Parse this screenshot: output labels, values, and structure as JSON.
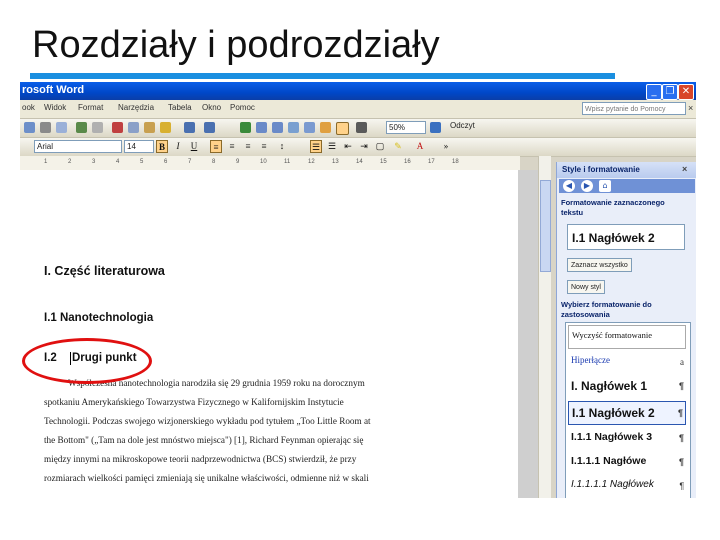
{
  "slide": {
    "title": "Rozdziały i podrozdziały"
  },
  "window": {
    "title": "rosoft Word"
  },
  "menu": [
    "ook",
    "Widok",
    "Format",
    "Narzędzia",
    "Tabela",
    "Okno",
    "Pomoc"
  ],
  "ask_placeholder": "Wpisz pytanie do Pomocy",
  "standard_toolbar": {
    "zoom": "50%",
    "read_label": "Odczyt"
  },
  "formatting_toolbar": {
    "font": "Arial",
    "size": "14",
    "bold": "B",
    "italic": "I",
    "underline": "U"
  },
  "ruler": [
    "1",
    "2",
    "3",
    "4",
    "5",
    "6",
    "7",
    "8",
    "9",
    "10",
    "11",
    "12",
    "13",
    "14",
    "15",
    "16",
    "17",
    "18"
  ],
  "document": {
    "heading1": "I.   Część literaturowa",
    "heading2a": "I.1   Nanotechnologia",
    "heading2b_num": "I.2",
    "heading2b_text": "Drugi punkt",
    "body_lines": [
      "Współczesna nanotechnologia narodziła się 29 grudnia 1959 roku na dorocznym",
      "spotkaniu Amerykańskiego Towarzystwa Fizycznego w Kalifornijskim Instytucie",
      "Technologii. Podczas swojego wizjonerskiego wykładu pod tytułem „Too Little Room at",
      "the Bottom\" („Tam na dole jest mnóstwo miejsca\") [1], Richard Feynman opierając się",
      "między innymi na mikroskopowe teorii nadprzewodnictwa (BCS) stwierdził, że przy",
      "rozmiarach wielkości pamięci zmieniają się unikalne właściwości, odmienne niż w skali"
    ]
  },
  "task_pane": {
    "title": "Style i formatowanie",
    "close": "×",
    "section1": "Formatowanie zaznaczonego tekstu",
    "current_style": "I.1  Nagłówek 2",
    "select_all": "Zaznacz wszystko",
    "new_style": "Nowy styl",
    "section2": "Wybierz formatowanie do zastosowania",
    "styles": [
      {
        "label": "Wyczyść formatowanie",
        "pil": ""
      },
      {
        "label": "Hiperłącze",
        "pil": "a"
      },
      {
        "label": "I.  Nagłówek 1",
        "pil": "¶"
      },
      {
        "label": "I.1  Nagłówek 2",
        "pil": "¶"
      },
      {
        "label": "I.1.1  Nagłówek 3",
        "pil": "¶"
      },
      {
        "label": "I.1.1.1  Nagłówe",
        "pil": "¶"
      },
      {
        "label": "I.1.1.1.1  Nagłówek",
        "pil": "¶"
      }
    ]
  },
  "colors": {
    "title_rule": "#1a8fe0",
    "annotation": "#e01010",
    "titlebar": "#0047c8"
  }
}
